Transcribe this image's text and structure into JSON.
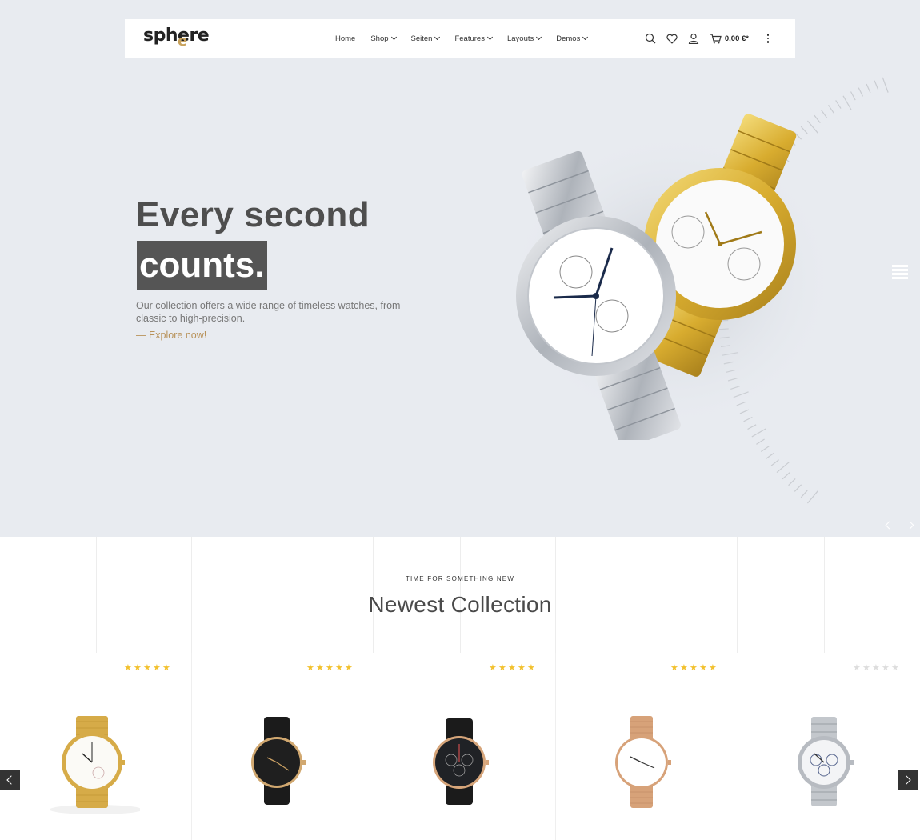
{
  "header": {
    "logo": {
      "part1": "sph",
      "part2": "e",
      "part3": "re"
    },
    "nav": [
      {
        "label": "Home",
        "has_dropdown": false
      },
      {
        "label": "Shop",
        "has_dropdown": true
      },
      {
        "label": "Seiten",
        "has_dropdown": true
      },
      {
        "label": "Features",
        "has_dropdown": true
      },
      {
        "label": "Layouts",
        "has_dropdown": true
      },
      {
        "label": "Demos",
        "has_dropdown": true
      }
    ],
    "tools": [
      "search-icon",
      "heart-icon",
      "user-icon",
      "cart-icon",
      "more-icon"
    ],
    "cart_total": "0,00 €*"
  },
  "hero": {
    "title_line1": "Every second",
    "title_line2": "counts.",
    "description": "Our collection offers a wide range of timeless watches, from classic to high-precision.",
    "cta": "— Explore now!"
  },
  "collection": {
    "kicker": "TIME FOR SOMETHING NEW",
    "title": "Newest Collection",
    "products": [
      {
        "rating": 5,
        "image": "gold-mesh-watch"
      },
      {
        "rating": 5,
        "image": "black-leather-watch"
      },
      {
        "rating": 5,
        "image": "black-chronograph-watch"
      },
      {
        "rating": 5,
        "image": "rosegold-mesh-watch"
      },
      {
        "rating": 0,
        "image": "silver-chronograph-watch"
      }
    ]
  },
  "colors": {
    "hero_bg": "#e8ebf0",
    "accent_gold": "#b8925a",
    "star": "#f2c12e",
    "title_bg": "#555555"
  }
}
